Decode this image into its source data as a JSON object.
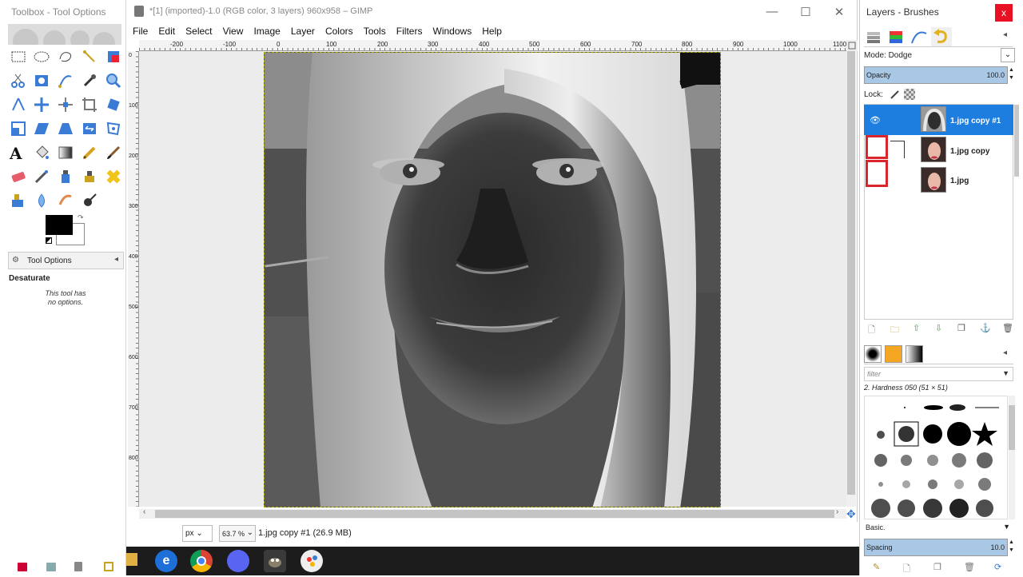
{
  "toolbox": {
    "title": "Toolbox - Tool Options",
    "tool_options_tab": "Tool Options",
    "tool_name": "Desaturate",
    "tool_message": "This tool has no options."
  },
  "window": {
    "title": "*[1] (imported)-1.0 (RGB color, 3 layers) 960x958 – GIMP",
    "menu": [
      "File",
      "Edit",
      "Select",
      "View",
      "Image",
      "Layer",
      "Colors",
      "Tools",
      "Filters",
      "Windows",
      "Help"
    ],
    "ruler_labels": [
      "-200",
      "-100",
      "0",
      "100",
      "200",
      "300",
      "400",
      "500",
      "600",
      "700",
      "800",
      "900",
      "1000",
      "1100"
    ],
    "ruler_v_labels": [
      "0",
      "100",
      "200",
      "300",
      "400",
      "500",
      "600",
      "700",
      "800"
    ],
    "status": {
      "unit": "px",
      "zoom": "63.7 %",
      "layer_info": "1.jpg copy #1 (26.9 MB)"
    }
  },
  "layers_panel": {
    "title": "Layers - Brushes",
    "mode_label": "Mode: Dodge",
    "opacity_label": "Opacity",
    "opacity_value": "100.0",
    "lock_label": "Lock:",
    "layers": [
      {
        "name": "1.jpg copy #1",
        "selected": true,
        "visible": true
      },
      {
        "name": "1.jpg copy",
        "selected": false,
        "visible": false
      },
      {
        "name": "1.jpg",
        "selected": false,
        "visible": false
      }
    ]
  },
  "brushes_panel": {
    "filter_placeholder": "filter",
    "brush_name": "2. Hardness 050 (51 × 51)",
    "preset": "Basic.",
    "spacing_label": "Spacing",
    "spacing_value": "10.0"
  },
  "colors": {
    "selected_layer_bg": "#1e7ee0",
    "annotation_red": "#d9262c",
    "taskbar": "#1c1c1c"
  }
}
